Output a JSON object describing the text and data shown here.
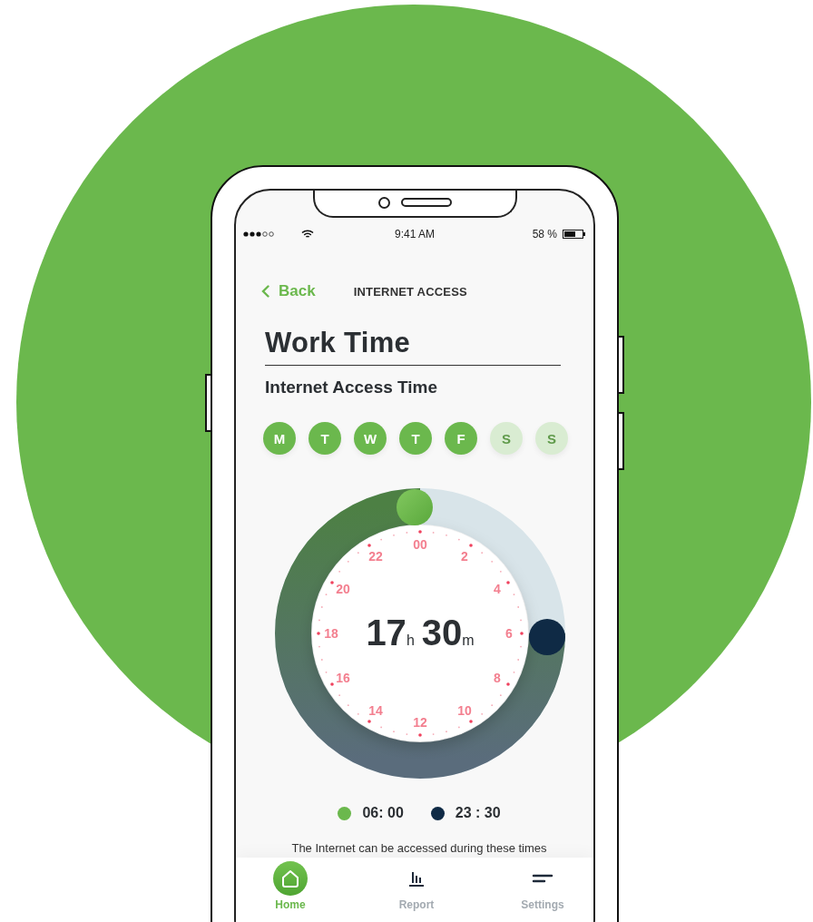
{
  "status_bar": {
    "time": "9:41 AM",
    "battery": "58 %"
  },
  "header": {
    "back": "Back",
    "title": "INTERNET ACCESS"
  },
  "heading": "Work Time",
  "subheading": "Internet Access Time",
  "days": [
    {
      "label": "M",
      "selected": true
    },
    {
      "label": "T",
      "selected": true
    },
    {
      "label": "W",
      "selected": true
    },
    {
      "label": "T",
      "selected": true
    },
    {
      "label": "F",
      "selected": true
    },
    {
      "label": "S",
      "selected": false
    },
    {
      "label": "S",
      "selected": false
    }
  ],
  "dial": {
    "hours": "17",
    "hours_unit": "h",
    "minutes": "30",
    "minutes_unit": "m",
    "hour_labels": [
      "00",
      "2",
      "4",
      "6",
      "8",
      "10",
      "12",
      "14",
      "16",
      "18",
      "20",
      "22"
    ]
  },
  "legend": [
    {
      "time": "06: 00",
      "color": "#6bb84d"
    },
    {
      "time": "23 : 30",
      "color": "#0f2a45"
    }
  ],
  "caption": "The Internet can be accessed during these times",
  "tabs": [
    {
      "label": "Home",
      "kind": "home",
      "selected": true
    },
    {
      "label": "Report",
      "kind": "chart",
      "selected": false
    },
    {
      "label": "Settings",
      "kind": "menu",
      "selected": false
    }
  ]
}
